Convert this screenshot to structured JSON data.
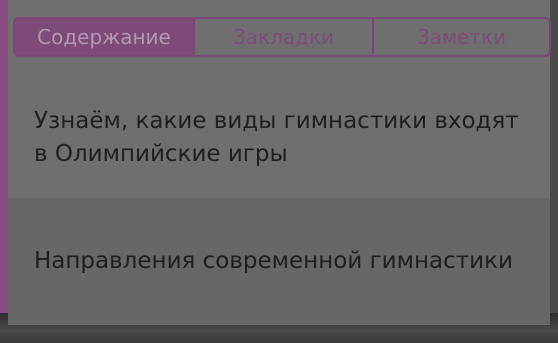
{
  "tabs": [
    {
      "label": "Содержание",
      "active": true
    },
    {
      "label": "Закладки",
      "active": false
    },
    {
      "label": "Заметки",
      "active": false
    }
  ],
  "contents": [
    {
      "title": "Узнаём, какие виды гимнастики входят в Олимпийские игры"
    },
    {
      "title": "Направления современной гимнастики"
    }
  ],
  "colors": {
    "accent": "#7d4a7a",
    "panel": "#6f6f6f",
    "text": "#1f1f1f"
  }
}
